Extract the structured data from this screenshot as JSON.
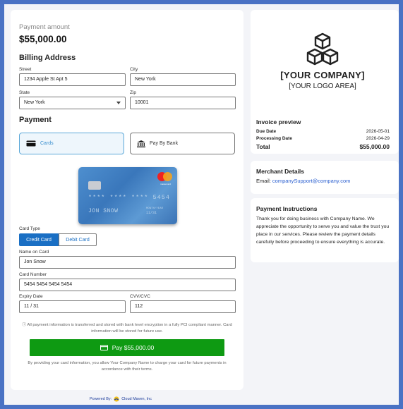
{
  "payment": {
    "amount_label": "Payment amount",
    "amount": "$55,000.00"
  },
  "billing": {
    "heading": "Billing Address",
    "street_label": "Street",
    "street": "1234 Apple St Apt 5",
    "city_label": "City",
    "city": "New York",
    "state_label": "State",
    "state": "New York",
    "zip_label": "Zip",
    "zip": "10001"
  },
  "payment_method": {
    "heading": "Payment",
    "cards_label": "Cards",
    "bank_label": "Pay By Bank"
  },
  "card_visual": {
    "number_mask": "**** **** **** 5454",
    "holder": "JON SNOW",
    "expiry_hint": "MONTH/YEAR",
    "expiry": "11/31",
    "brand_text": "mastercard"
  },
  "card_form": {
    "type_label": "Card Type",
    "credit_label": "Credit Card",
    "debit_label": "Debit Card",
    "name_label": "Name on Card",
    "name": "Jon Snow",
    "number_label": "Card Number",
    "number": "5454 5454 5454 5454",
    "expiry_label": "Expiry Date",
    "expiry": "11 / 31",
    "cvv_label": "CVV/CVC",
    "cvv": "112"
  },
  "notes": {
    "security": "ⓘ All payment information is transferred and stored with bank level encryption in a fully PCI compliant manner. Card information will be stored for future use.",
    "pay_button": "Pay $55,000.00",
    "consent": "By providing your card information, you allow Your Company Name to charge your card for future payments in accordance with their terms."
  },
  "company": {
    "name": "[YOUR COMPANY]",
    "logo_sub": "[YOUR LOGO AREA]"
  },
  "invoice": {
    "heading": "Invoice preview",
    "due_label": "Due Date",
    "due": "2026-05-01",
    "processing_label": "Processing Date",
    "processing": "2026-04-29",
    "total_label": "Total",
    "total": "$55,000.00"
  },
  "merchant": {
    "heading": "Merchant Details",
    "email_label": "Email: ",
    "email": "companySupport@company.com"
  },
  "instructions": {
    "heading": "Payment Instructions",
    "body": "Thank you for doing business with Company Name. We appreciate the opportunity to serve you and value the trust you place in our services. Please review the payment details carefully before proceeding to ensure everything is accurate."
  },
  "footer": {
    "powered_label": "Powered By:",
    "brand": "Cloud Maven, Inc"
  },
  "colors": {
    "accent": "#1a6fc4",
    "pay_green": "#0e9a12",
    "frame_blue": "#4a72c4"
  }
}
